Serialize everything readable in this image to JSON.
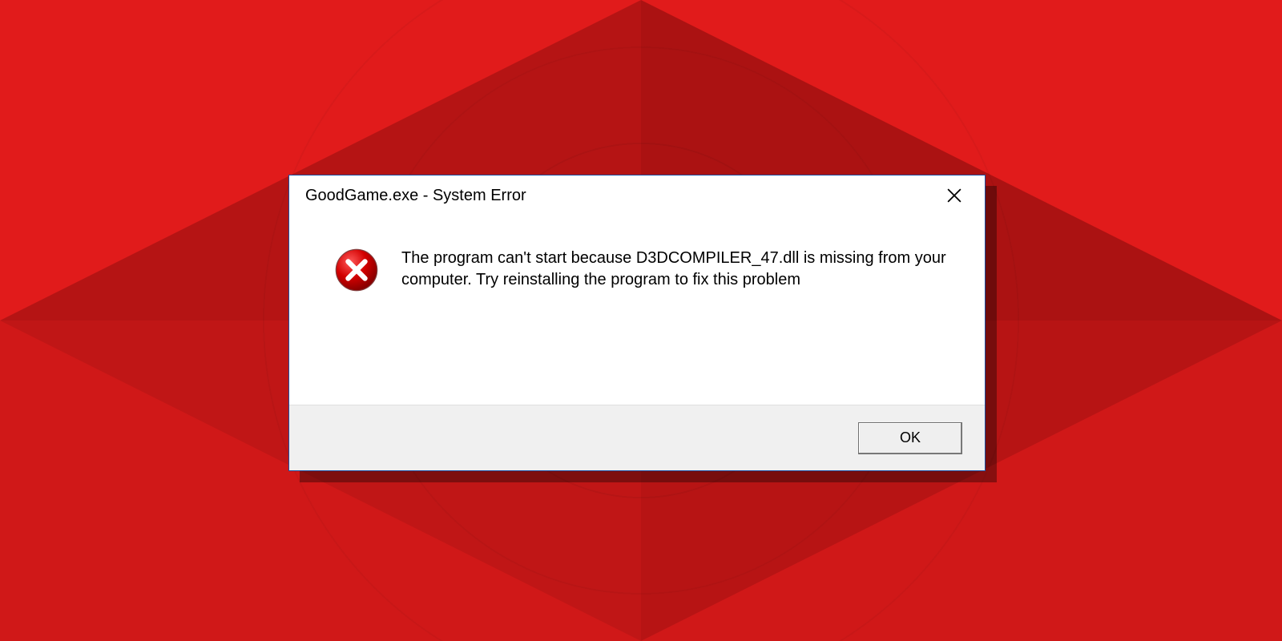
{
  "dialog": {
    "title": "GoodGame.exe - System Error",
    "message": "The program can't start because D3DCOMPILER_47.dll is missing from your computer. Try reinstalling the program to fix this problem",
    "ok_label": "OK"
  }
}
